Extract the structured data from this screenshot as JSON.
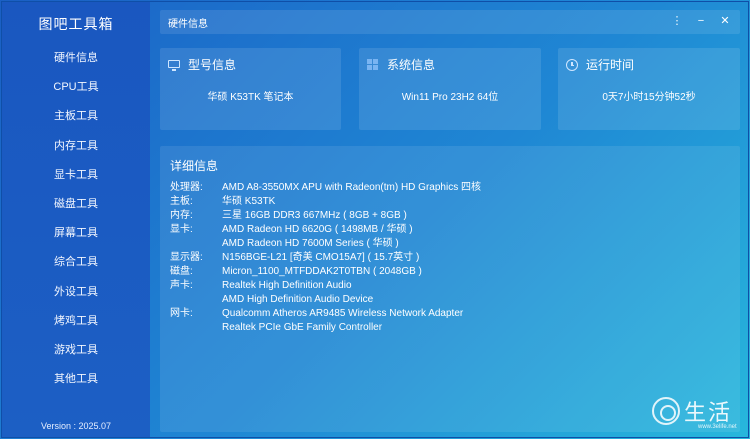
{
  "app": {
    "title": "图吧工具箱",
    "version": "Version : 2025.07"
  },
  "sidebar": {
    "items": [
      {
        "label": "硬件信息"
      },
      {
        "label": "CPU工具"
      },
      {
        "label": "主板工具"
      },
      {
        "label": "内存工具"
      },
      {
        "label": "显卡工具"
      },
      {
        "label": "磁盘工具"
      },
      {
        "label": "屏幕工具"
      },
      {
        "label": "综合工具"
      },
      {
        "label": "外设工具"
      },
      {
        "label": "烤鸡工具"
      },
      {
        "label": "游戏工具"
      },
      {
        "label": "其他工具"
      }
    ]
  },
  "titlebar": {
    "title": "硬件信息",
    "menu_glyph": "⋮",
    "minimize_glyph": "−",
    "close_glyph": "✕"
  },
  "cards": {
    "model": {
      "title": "型号信息",
      "value": "华硕  K53TK 笔记本",
      "icon": "monitor-icon"
    },
    "system": {
      "title": "系统信息",
      "value": "Win11 Pro 23H2 64位",
      "icon": "windows-icon"
    },
    "uptime": {
      "title": "运行时间",
      "value": "0天7小时15分钟52秒",
      "icon": "clock-icon"
    }
  },
  "detail": {
    "title": "详细信息",
    "rows": [
      {
        "label": "处理器:",
        "value": "AMD A8-3550MX APU with Radeon(tm) HD Graphics 四核"
      },
      {
        "label": "主板:",
        "value": "华硕 K53TK"
      },
      {
        "label": "内存:",
        "value": "三星 16GB DDR3 667MHz ( 8GB + 8GB )"
      },
      {
        "label": "显卡:",
        "value": "AMD Radeon HD 6620G ( 1498MB / 华硕 )"
      },
      {
        "label": "",
        "value": "AMD Radeon HD 7600M Series ( 华硕 )"
      },
      {
        "label": "显示器:",
        "value": "N156BGE-L21 [奇美 CMO15A7] ( 15.7英寸 )"
      },
      {
        "label": "磁盘:",
        "value": "Micron_1100_MTFDDAK2T0TBN ( 2048GB )"
      },
      {
        "label": "声卡:",
        "value": "Realtek High Definition Audio"
      },
      {
        "label": "",
        "value": "AMD High Definition Audio Device"
      },
      {
        "label": "网卡:",
        "value": "Qualcomm Atheros AR9485 Wireless Network Adapter"
      },
      {
        "label": "",
        "value": "Realtek PCIe GbE Family Controller"
      }
    ]
  },
  "watermark": {
    "text": "生活",
    "url": "www.3elife.net"
  }
}
